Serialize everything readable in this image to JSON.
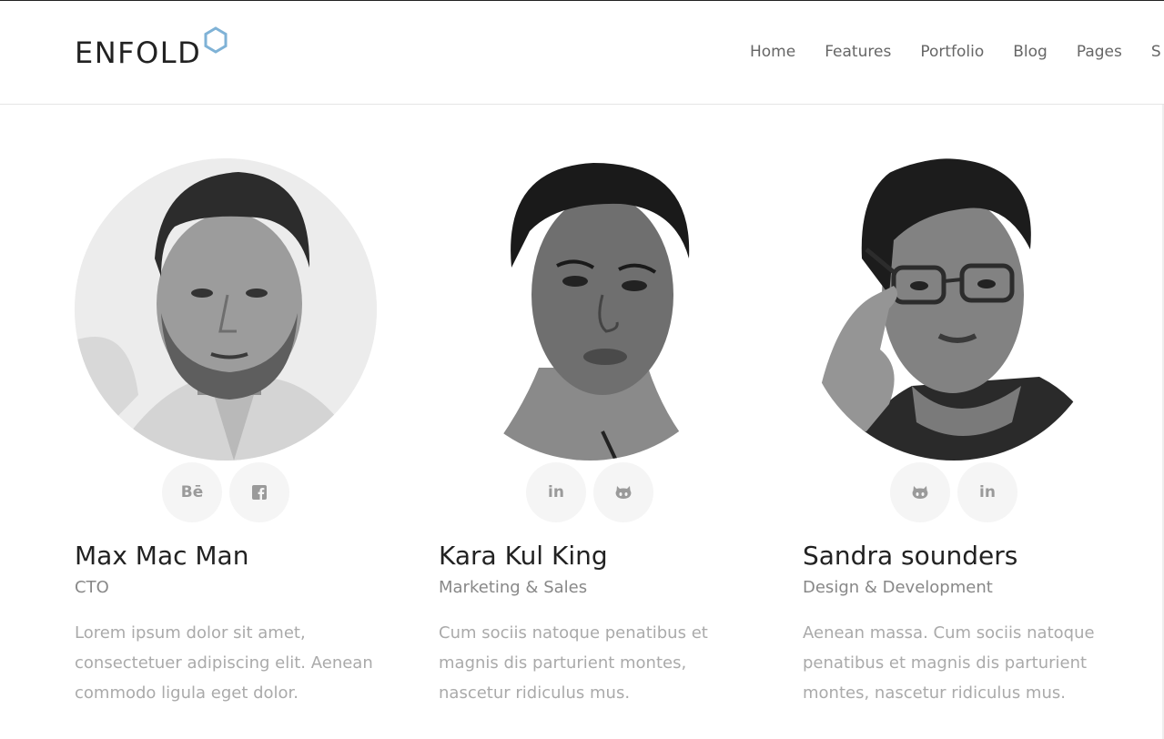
{
  "header": {
    "logo_text": "ENFOLD",
    "logo_accent_color": "#7fb2d6",
    "nav": [
      "Home",
      "Features",
      "Portfolio",
      "Blog",
      "Pages",
      "S"
    ]
  },
  "team": [
    {
      "name": "Max Mac Man",
      "role": "CTO",
      "description": "Lorem ipsum dolor sit amet, consectetuer adipiscing elit. Aenean commodo ligula eget dolor.",
      "socials": [
        {
          "icon": "behance-icon",
          "glyph": "Bē"
        },
        {
          "icon": "facebook-icon",
          "glyph": "f"
        }
      ]
    },
    {
      "name": "Kara Kul King",
      "role": "Marketing & Sales",
      "description": "Cum sociis natoque penatibus et magnis dis parturient montes, nascetur ridiculus mus.",
      "socials": [
        {
          "icon": "linkedin-icon",
          "glyph": "in"
        },
        {
          "icon": "github-icon",
          "glyph": ""
        }
      ]
    },
    {
      "name": "Sandra sounders",
      "role": "Design & Development",
      "description": "Aenean massa. Cum sociis natoque penatibus et magnis dis parturient montes, nascetur ridiculus mus.",
      "socials": [
        {
          "icon": "github-icon",
          "glyph": ""
        },
        {
          "icon": "linkedin-icon",
          "glyph": "in"
        }
      ]
    }
  ]
}
